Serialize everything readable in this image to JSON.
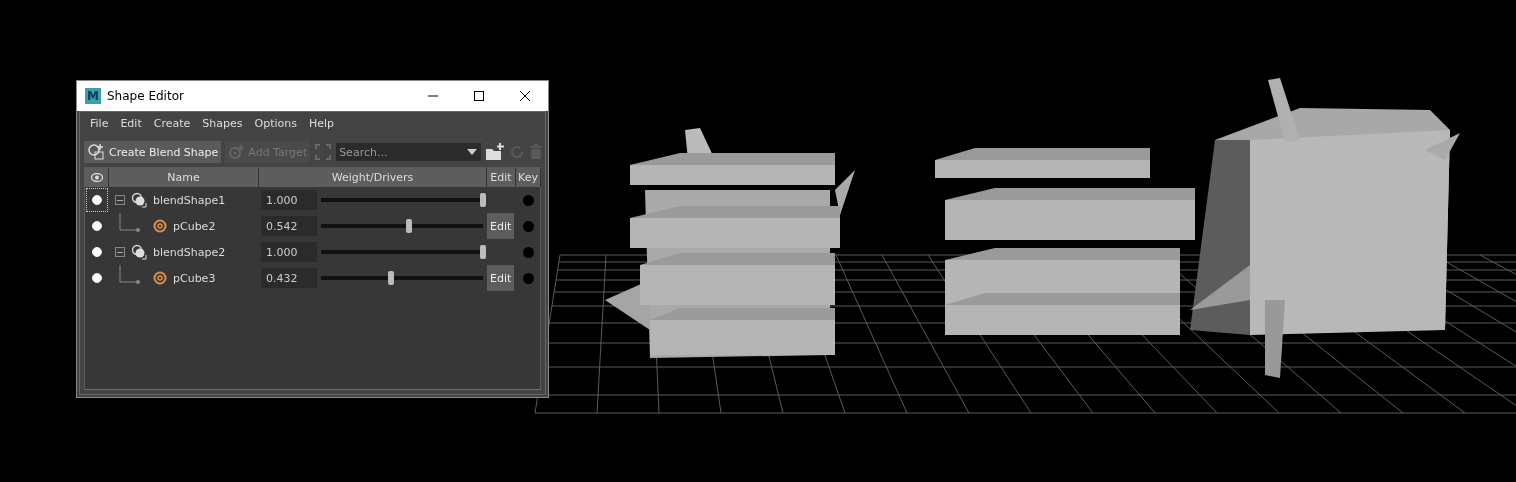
{
  "window": {
    "title": "Shape Editor",
    "logo": "M"
  },
  "menu": [
    "File",
    "Edit",
    "Create",
    "Shapes",
    "Options",
    "Help"
  ],
  "toolbar": {
    "create_button": "Create Blend Shape",
    "add_target_button": {
      "label": "Add Target",
      "disabled": true
    },
    "search": {
      "placeholder": "Search..."
    }
  },
  "columns": [
    "Name",
    "Weight/Drivers",
    "Edit",
    "Key"
  ],
  "blend_shapes": [
    {
      "name": "blendShape1",
      "weight": "1.000",
      "level": 1.0,
      "visible": true,
      "focused": true,
      "expanded": true,
      "children": [
        {
          "name": "pCube2",
          "weight": "0.542",
          "level": 0.542,
          "visible": true,
          "focused": false,
          "edit_button": "Edit"
        }
      ]
    },
    {
      "name": "blendShape2",
      "weight": "1.000",
      "level": 1.0,
      "visible": true,
      "focused": false,
      "expanded": true,
      "children": [
        {
          "name": "pCube3",
          "weight": "0.432",
          "level": 0.432,
          "visible": true,
          "focused": false,
          "edit_button": "Edit"
        }
      ]
    }
  ]
}
